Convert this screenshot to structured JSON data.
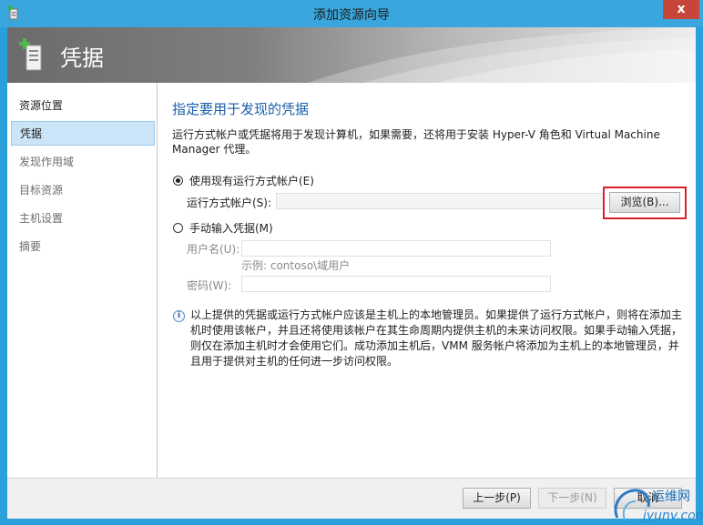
{
  "window": {
    "title": "添加资源向导",
    "close_glyph": "x"
  },
  "banner": {
    "title": "凭据"
  },
  "sidebar": {
    "items": [
      {
        "label": "资源位置",
        "state": "normal"
      },
      {
        "label": "凭据",
        "state": "active"
      },
      {
        "label": "发现作用域",
        "state": "muted"
      },
      {
        "label": "目标资源",
        "state": "muted"
      },
      {
        "label": "主机设置",
        "state": "muted"
      },
      {
        "label": "摘要",
        "state": "muted"
      }
    ]
  },
  "main": {
    "heading": "指定要用于发现的凭据",
    "description": "运行方式帐户或凭据将用于发现计算机，如果需要，还将用于安装 Hyper-V 角色和 Virtual Machine Manager 代理。",
    "option_run_as": {
      "label": "使用现有运行方式帐户(E)",
      "checked": true,
      "field_label": "运行方式帐户(S):",
      "field_value": "",
      "browse_label": "浏览(B)..."
    },
    "option_manual": {
      "label": "手动输入凭据(M)",
      "checked": false,
      "username_label": "用户名(U):",
      "username_value": "",
      "username_hint": "示例: contoso\\域用户",
      "password_label": "密码(W):",
      "password_value": ""
    },
    "info_icon": "info-icon",
    "info_text": "以上提供的凭据或运行方式帐户应该是主机上的本地管理员。如果提供了运行方式帐户，则将在添加主机时使用该帐户，并且还将使用该帐户在其生命周期内提供主机的未来访问权限。如果手动输入凭据，则仅在添加主机时才会使用它们。成功添加主机后，VMM 服务帐户将添加为主机上的本地管理员，并且用于提供对主机的任何进一步访问权限。"
  },
  "footer": {
    "prev_label": "上一步(P)",
    "next_label": "下一步(N)",
    "cancel_label": "取消"
  },
  "watermark": {
    "text_top": "运维网",
    "text_bottom": "iyunv.com"
  },
  "colors": {
    "title_bar": "#39a7de",
    "heading": "#1a5fa8",
    "active_item": "#cce4f7",
    "highlight": "#d8202a",
    "close": "#c7463b"
  }
}
